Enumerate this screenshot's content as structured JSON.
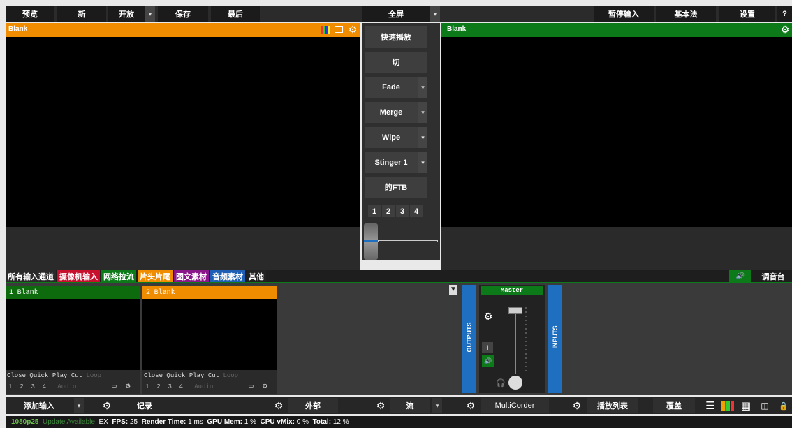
{
  "topbar": {
    "preview": "预览",
    "new": "新",
    "open": "开放",
    "save": "保存",
    "last": "最后",
    "fullscreen": "全屏",
    "pause_input": "暂停输入",
    "basic": "基本法",
    "settings": "设置",
    "help": "?"
  },
  "preview": {
    "title": "Blank"
  },
  "output": {
    "title": "Blank"
  },
  "transitions": {
    "quick_play": "快速播放",
    "cut": "切",
    "fade": "Fade",
    "merge": "Merge",
    "wipe": "Wipe",
    "stinger": "Stinger 1",
    "ftb": "的FTB",
    "pages": [
      "1",
      "2",
      "3",
      "4"
    ]
  },
  "input_tabs": [
    {
      "label": "所有输入通道",
      "color": "#2a2a2a"
    },
    {
      "label": "摄像机输入",
      "color": "#c8102e"
    },
    {
      "label": "网络拉流",
      "color": "#0d7a1a"
    },
    {
      "label": "片头片尾",
      "color": "#f08c00"
    },
    {
      "label": "图文素材",
      "color": "#8a178a"
    },
    {
      "label": "音频素材",
      "color": "#1e5fb5"
    },
    {
      "label": "其他",
      "color": "#222222"
    }
  ],
  "audio_mixer": {
    "label": "调音台",
    "speaker": "🔊"
  },
  "inputs": [
    {
      "number": "1",
      "name": "Blank",
      "header_color": "#0d6b0d",
      "close": "Close",
      "quick_play": "Quick Play",
      "cut": "Cut",
      "loop": "Loop",
      "pages": [
        "1",
        "2",
        "3",
        "4"
      ],
      "audio": "Audio"
    },
    {
      "number": "2",
      "name": "Blank",
      "header_color": "#f08c00",
      "close": "Close",
      "quick_play": "Quick Play",
      "cut": "Cut",
      "loop": "Loop",
      "pages": [
        "1",
        "2",
        "3",
        "4"
      ],
      "audio": "Audio"
    }
  ],
  "mixer": {
    "master": "Master",
    "outputs": "OUTPUTS",
    "inputs": "INPUTS",
    "info": "i"
  },
  "bottombar": {
    "add_input": "添加输入",
    "record": "记录",
    "external": "外部",
    "stream": "流",
    "multicorder": "MultiCorder",
    "playlist": "播放列表",
    "overlay": "覆盖"
  },
  "status": {
    "resolution": "1080p25",
    "update": "Update Available",
    "ex": "EX",
    "fps_label": "FPS:",
    "fps": "25",
    "render_label": "Render Time:",
    "render": "1 ms",
    "gpu_label": "GPU Mem:",
    "gpu": "1 %",
    "cpu_label": "CPU vMix:",
    "cpu": "0 %",
    "total_label": "Total:",
    "total": "12 %"
  },
  "colors": {
    "preview_bar": "#f08c00",
    "output_bar": "#0d7a1a",
    "accent_blue": "#1e6fc0"
  }
}
